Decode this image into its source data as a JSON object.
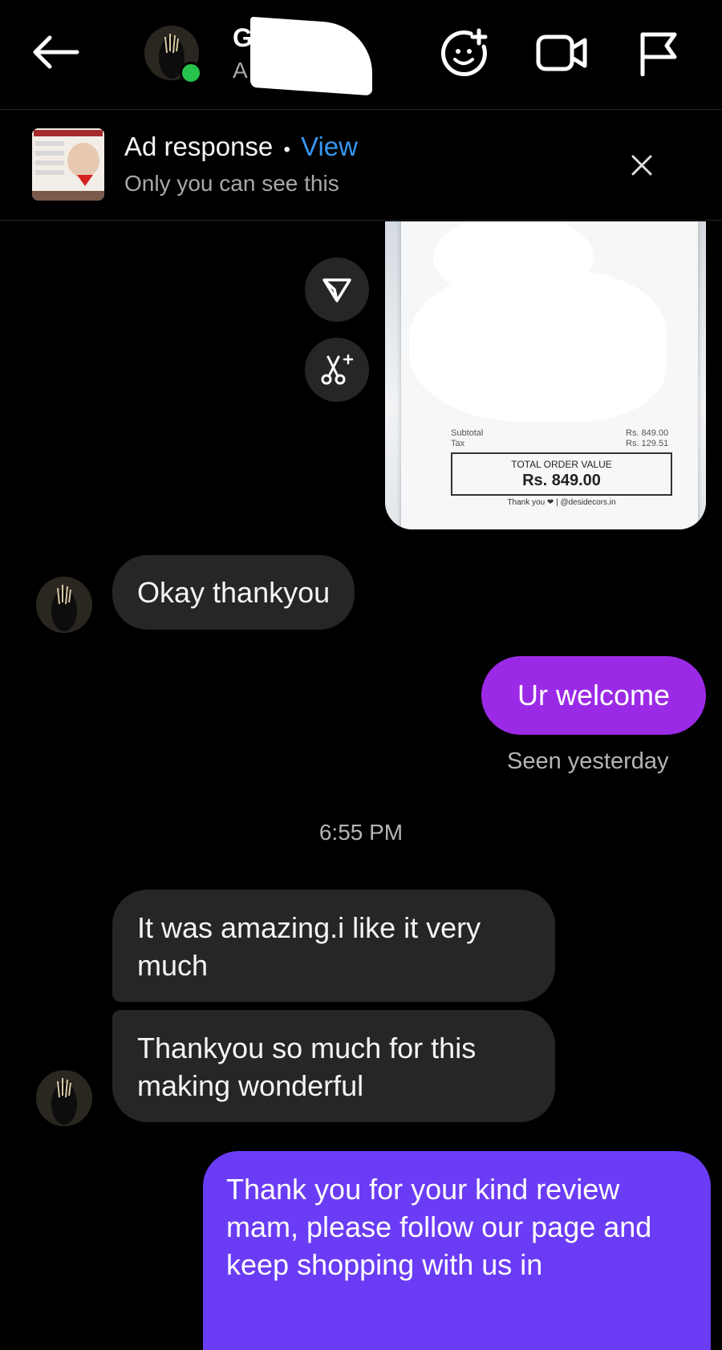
{
  "header": {
    "contact_name": "G",
    "contact_name_trail": "💙",
    "contact_subtitle": "A"
  },
  "icons": {
    "back": "arrow-left-icon",
    "effects": "face-plus-icon",
    "video": "video-camera-icon",
    "report": "flag-icon"
  },
  "ad_banner": {
    "title": "Ad response",
    "separator": "•",
    "view_link": "View",
    "subtitle": "Only you can see this"
  },
  "receipt": {
    "subtotal_label": "Subtotal",
    "subtotal_value": "Rs. 849.00",
    "tax_label": "Tax",
    "tax_value": "Rs. 129.51",
    "total_label": "TOTAL ORDER VALUE",
    "total_value": "Rs. 849.00",
    "footer": "Thank you ❤ | @desidecors.in"
  },
  "messages": [
    {
      "from": "them",
      "text": "Okay thankyou"
    },
    {
      "from": "me",
      "text": "Ur welcome",
      "status": "Seen yesterday"
    },
    {
      "from": "them",
      "text": "It was amazing.i like it very much"
    },
    {
      "from": "them",
      "text": "Thankyou so much for this making wonderful"
    },
    {
      "from": "me",
      "text": "Thank you for your kind review mam, please follow our page and keep shopping with us in"
    }
  ],
  "timestamp": "6:55 PM",
  "colors": {
    "background": "#000000",
    "incoming_bubble": "#262626",
    "outgoing_bubble_1": "#9b2ae6",
    "outgoing_bubble_2": "#6b3cf5",
    "link": "#3797f0",
    "online": "#27c24c"
  }
}
